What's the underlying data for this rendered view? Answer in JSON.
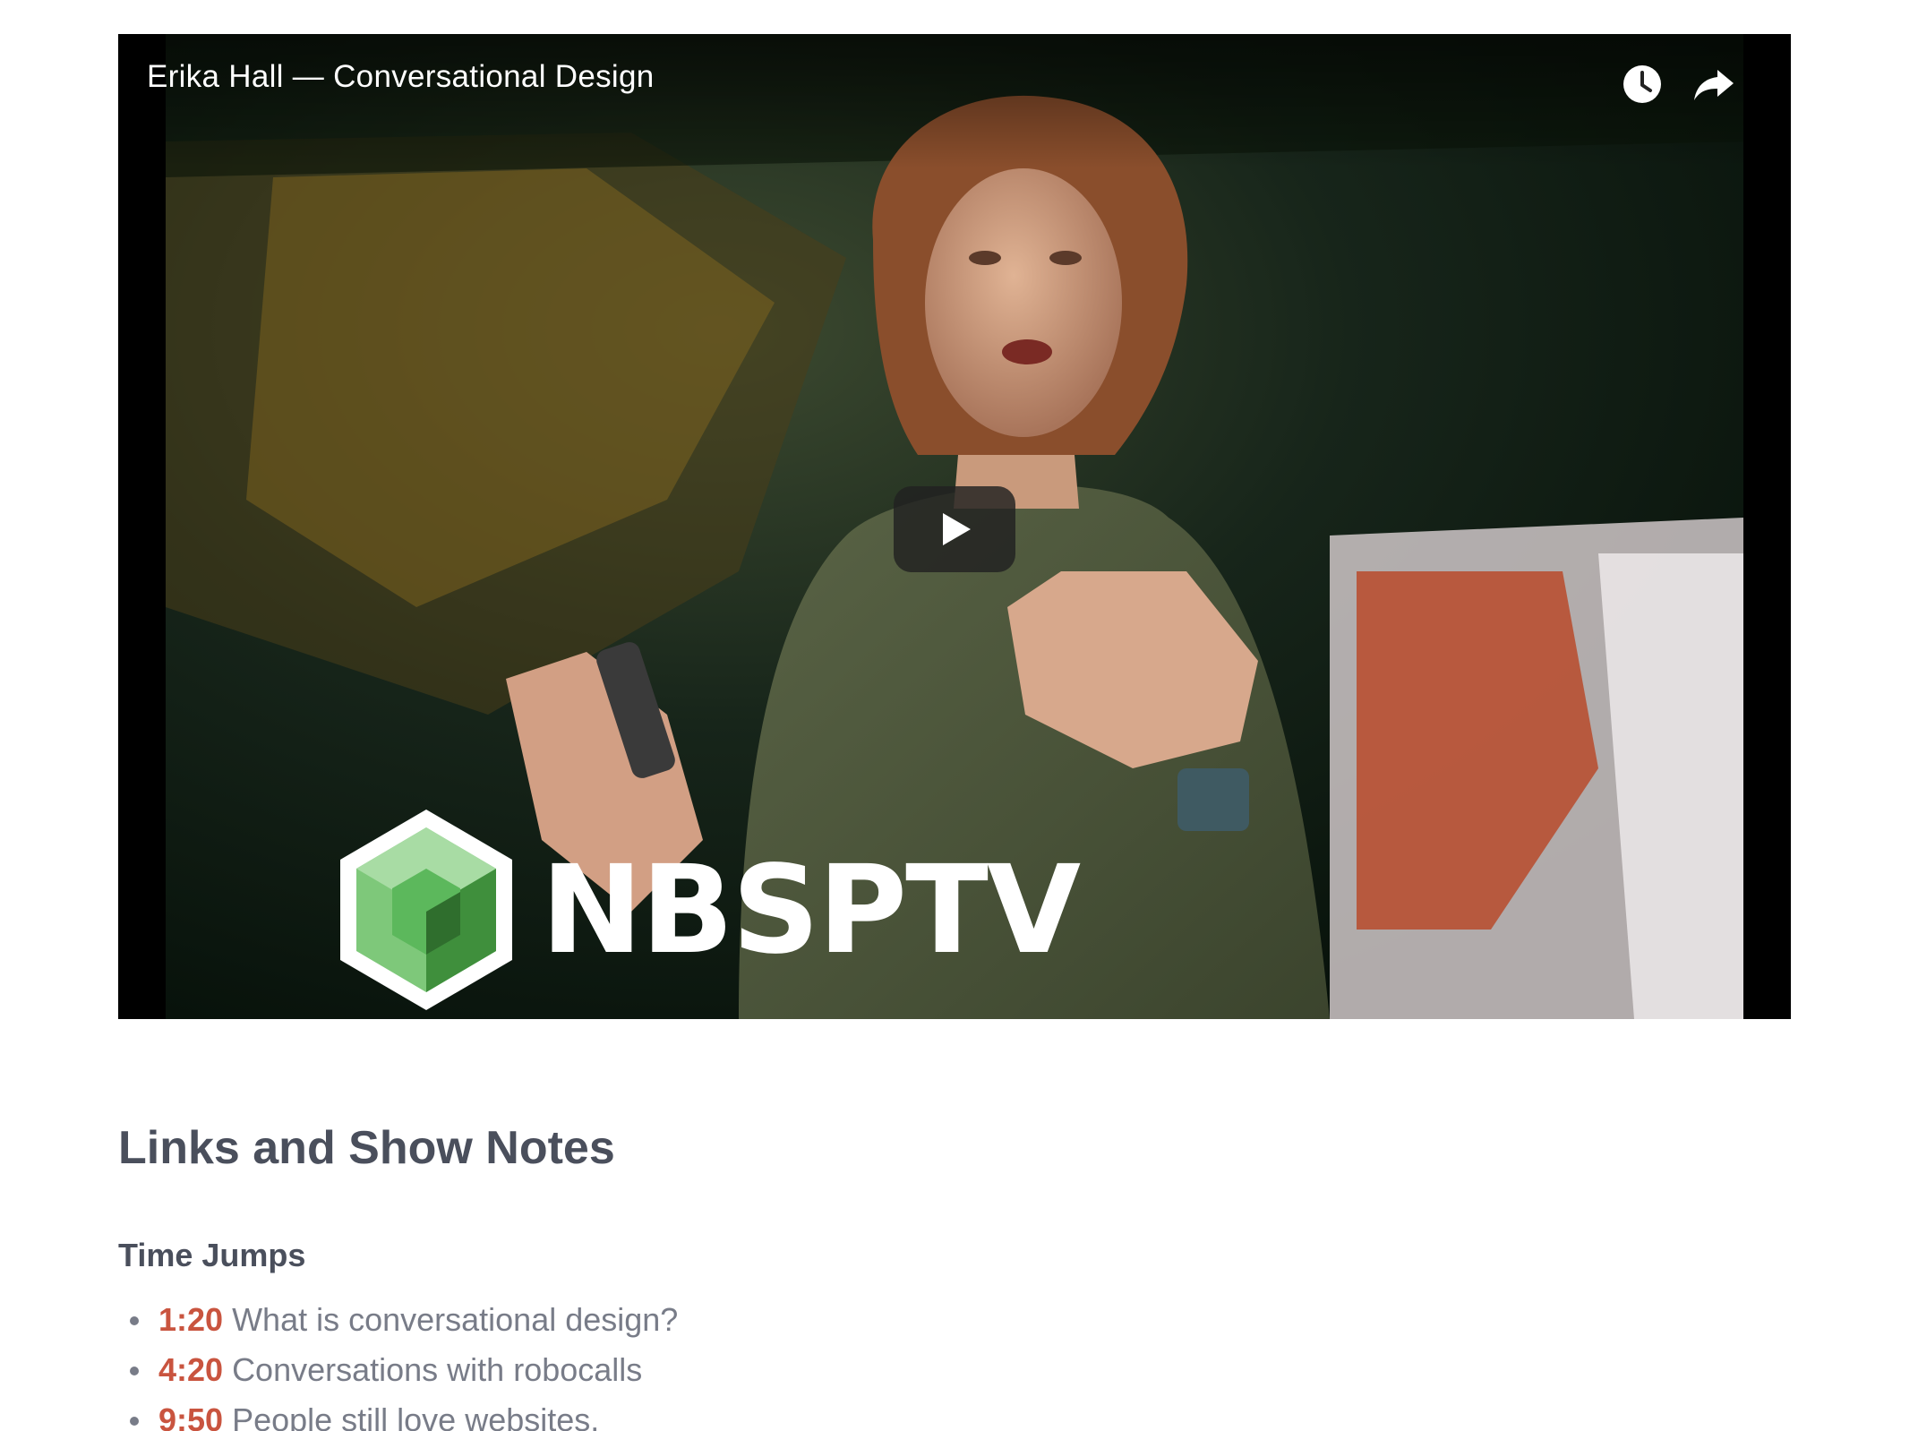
{
  "video": {
    "title": "Erika Hall — Conversational Design",
    "brand": "NBSPTV",
    "controls": {
      "watch_later_icon": "clock-icon",
      "share_icon": "share-arrow-icon",
      "play_icon": "play-icon"
    }
  },
  "show_notes": {
    "heading": "Links and Show Notes",
    "time_jumps": {
      "heading": "Time Jumps",
      "items": [
        {
          "time": "1:20",
          "text": "What is conversational design?"
        },
        {
          "time": "4:20",
          "text": "Conversations with robocalls"
        },
        {
          "time": "9:50",
          "text": "People still love websites."
        }
      ]
    }
  },
  "colors": {
    "heading_text": "#4a4f5c",
    "body_text": "#787c88",
    "time_link": "#c9543f",
    "brand_green": "#5cb85c"
  }
}
